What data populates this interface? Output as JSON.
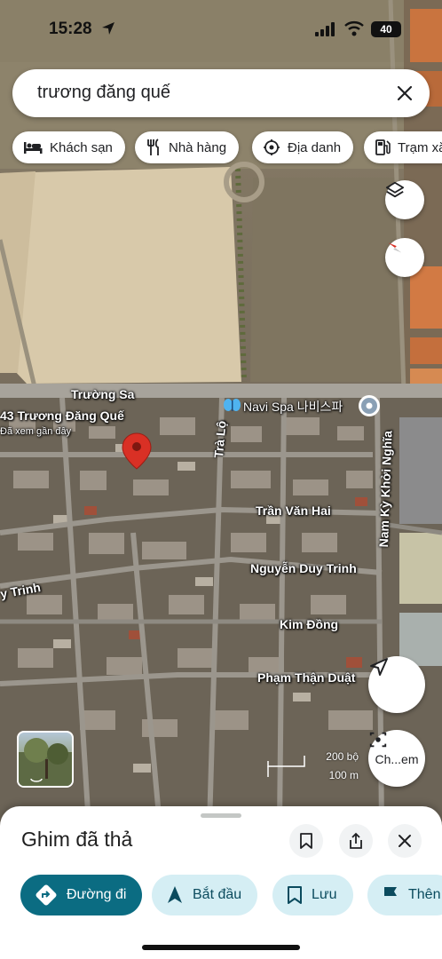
{
  "status_bar": {
    "time": "15:28",
    "battery": "40",
    "icons": [
      "location-arrow-icon",
      "signal-icon",
      "wifi-icon",
      "battery-icon"
    ]
  },
  "search": {
    "query": "trương đăng quế",
    "clear_icon": "close-icon"
  },
  "chips": [
    {
      "label": "Khách sạn",
      "icon": "hotel-bed-icon"
    },
    {
      "label": "Nhà hàng",
      "icon": "restaurant-icon"
    },
    {
      "label": "Địa danh",
      "icon": "landmark-icon"
    },
    {
      "label": "Trạm xă",
      "icon": "gas-station-icon"
    }
  ],
  "map": {
    "place_labels": {
      "poi_address": "43 Trương Đăng Quế",
      "poi_viewed": "Đã xem gần đây",
      "navi_spa": "Navi Spa 나비스파"
    },
    "streets": {
      "truong_sa": "Trường Sa",
      "tra_lo": "Trà Lộ",
      "tran_van_hai": "Trần Văn Hai",
      "nguyen_duy_trinh": "Nguyễn Duy Trinh",
      "duy_trinh_left": "y Trinh",
      "kim_dong": "Kim Đồng",
      "pham_than_duat": "Phạm Thận Duật",
      "nam_ky_khoi_nghia": "Nam Kỳ Khởi Nghĩa"
    },
    "scale": {
      "imperial": "200 bộ",
      "metric": "100 m"
    },
    "view_toggle_label": "Ch...em",
    "colors": {
      "pin": "#d93025",
      "accent": "#0b6c82"
    }
  },
  "sheet": {
    "title": "Ghim đã thả",
    "actions": {
      "directions": "Đường đi",
      "start": "Bắt đầu",
      "save": "Lưu",
      "add": "Thên"
    }
  }
}
